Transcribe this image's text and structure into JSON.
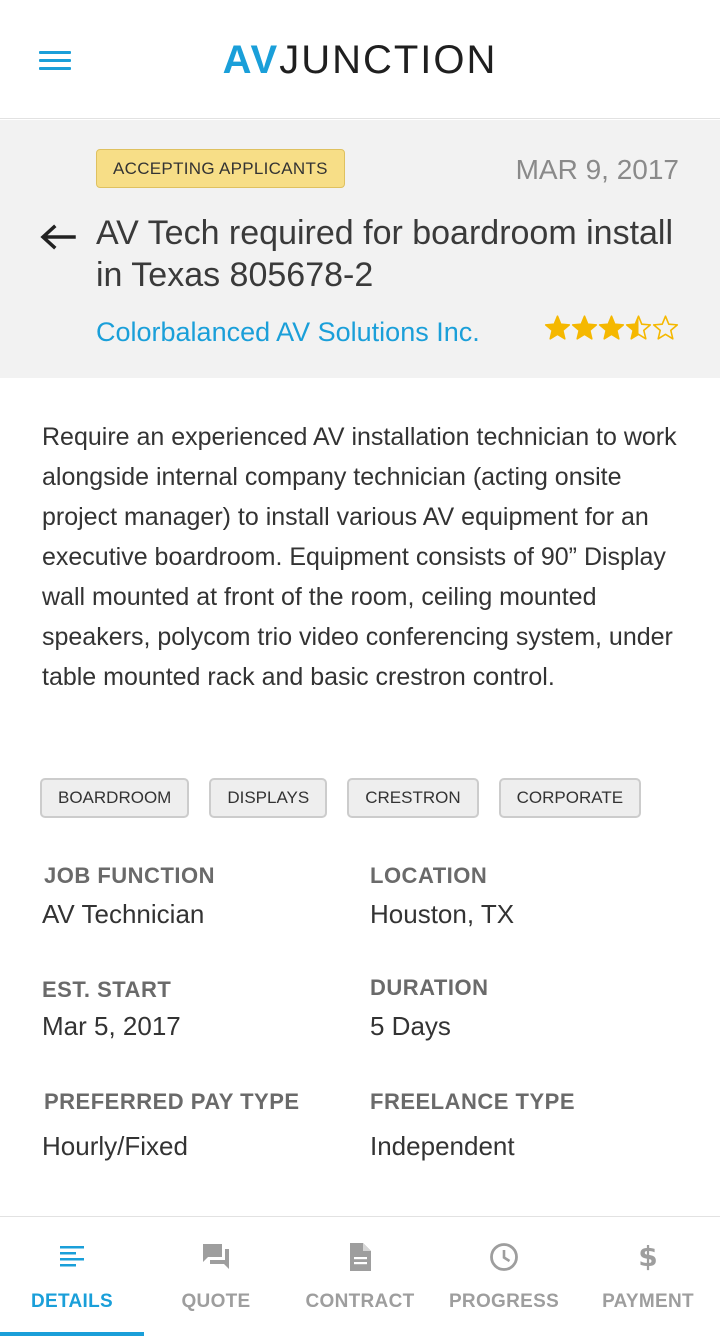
{
  "app": {
    "logo_av": "AV",
    "logo_junction": "JUNCTION"
  },
  "job": {
    "status_badge": "ACCEPTING APPLICANTS",
    "date": "MAR 9, 2017",
    "title": "AV Tech required for boardroom install in Texas 805678-2",
    "company": "Colorbalanced AV Solutions Inc.",
    "rating": 3.5,
    "rating_max": 5,
    "description": "Require an experienced AV installation technician to work alongside internal company technician (acting onsite project manager) to install various AV equipment for an executive boardroom. Equipment consists of 90” Display wall mounted at front of the room, ceiling mounted speakers, polycom trio video conferencing system, under table mounted rack and basic crestron control.",
    "tags": [
      "BOARDROOM",
      "DISPLAYS",
      "CRESTRON",
      "CORPORATE"
    ],
    "details": {
      "job_function_label": "JOB FUNCTION",
      "job_function": "AV Technician",
      "location_label": "LOCATION",
      "location": "Houston, TX",
      "est_start_label": "EST. START",
      "est_start": "Mar 5, 2017",
      "duration_label": "DURATION",
      "duration": "5 Days",
      "pay_type_label": "PREFERRED PAY TYPE",
      "pay_type": "Hourly/Fixed",
      "freelance_type_label": "FREELANCE TYPE",
      "freelance_type": "Independent"
    }
  },
  "nav": {
    "tabs": [
      {
        "label": "DETAILS",
        "icon": "details-icon",
        "active": true
      },
      {
        "label": "QUOTE",
        "icon": "chat-icon",
        "active": false
      },
      {
        "label": "CONTRACT",
        "icon": "document-icon",
        "active": false
      },
      {
        "label": "PROGRESS",
        "icon": "clock-icon",
        "active": false
      },
      {
        "label": "PAYMENT",
        "icon": "dollar-icon",
        "active": false
      }
    ]
  },
  "colors": {
    "accent": "#1a9fd9",
    "badge": "#f7de87",
    "star": "#f5b800"
  }
}
